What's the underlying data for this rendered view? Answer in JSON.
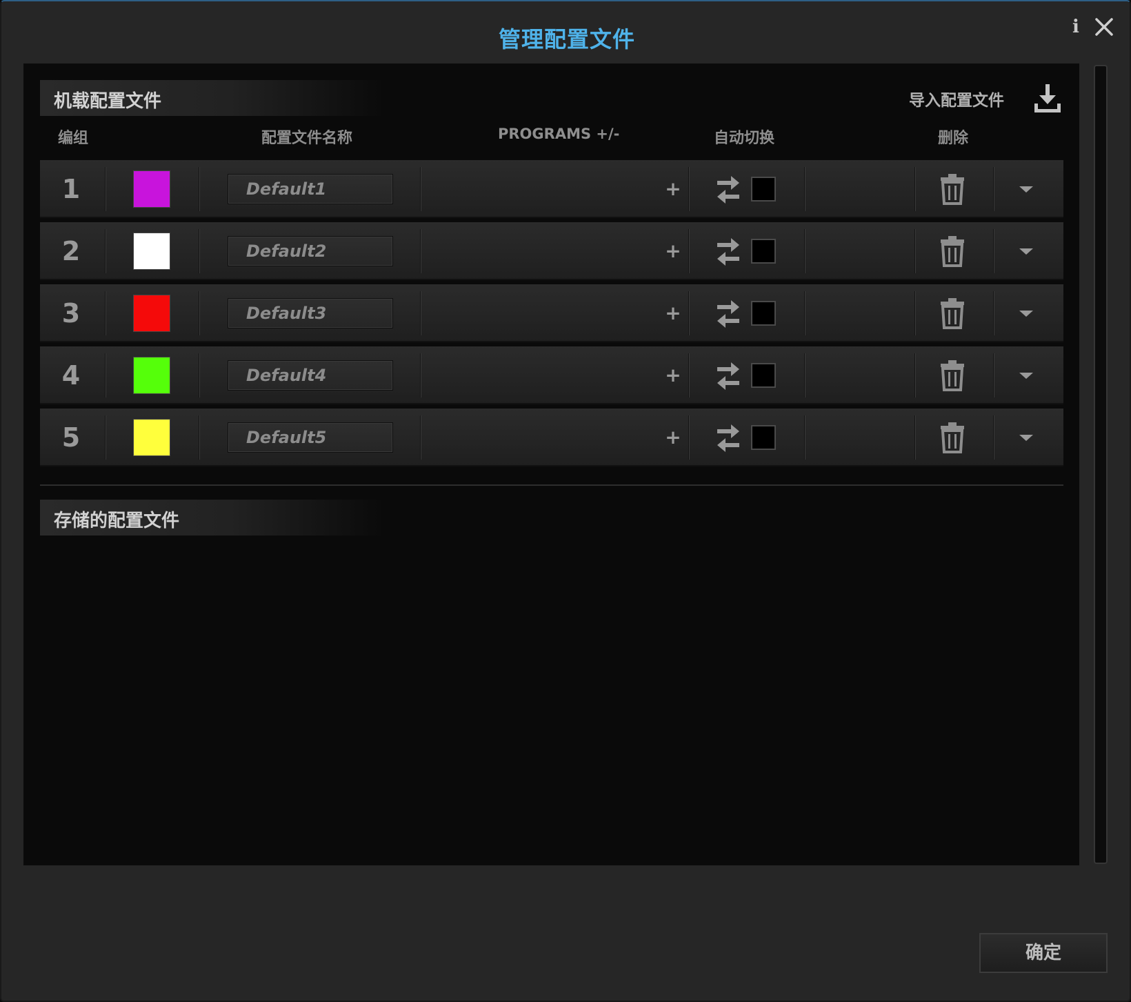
{
  "dialog": {
    "title": "管理配置文件",
    "info_label": "i",
    "ok_label": "确定"
  },
  "onboard": {
    "section_title": "机载配置文件",
    "import_label": "导入配置文件",
    "columns": {
      "group": "编组",
      "name": "配置文件名称",
      "programs": "PROGRAMS +/-",
      "auto_switch": "自动切换",
      "delete": "删除"
    },
    "plus_label": "+",
    "profiles": [
      {
        "num": "1",
        "color": "#c814dc",
        "name": "Default1"
      },
      {
        "num": "2",
        "color": "#ffffff",
        "name": "Default2"
      },
      {
        "num": "3",
        "color": "#f50a0a",
        "name": "Default3"
      },
      {
        "num": "4",
        "color": "#55ff0a",
        "name": "Default4"
      },
      {
        "num": "5",
        "color": "#ffff3c",
        "name": "Default5"
      }
    ]
  },
  "stored": {
    "section_title": "存储的配置文件"
  },
  "colors": {
    "title_accent": "#4fb3ea",
    "background": "#262626",
    "panel": "#0a0a0a"
  }
}
